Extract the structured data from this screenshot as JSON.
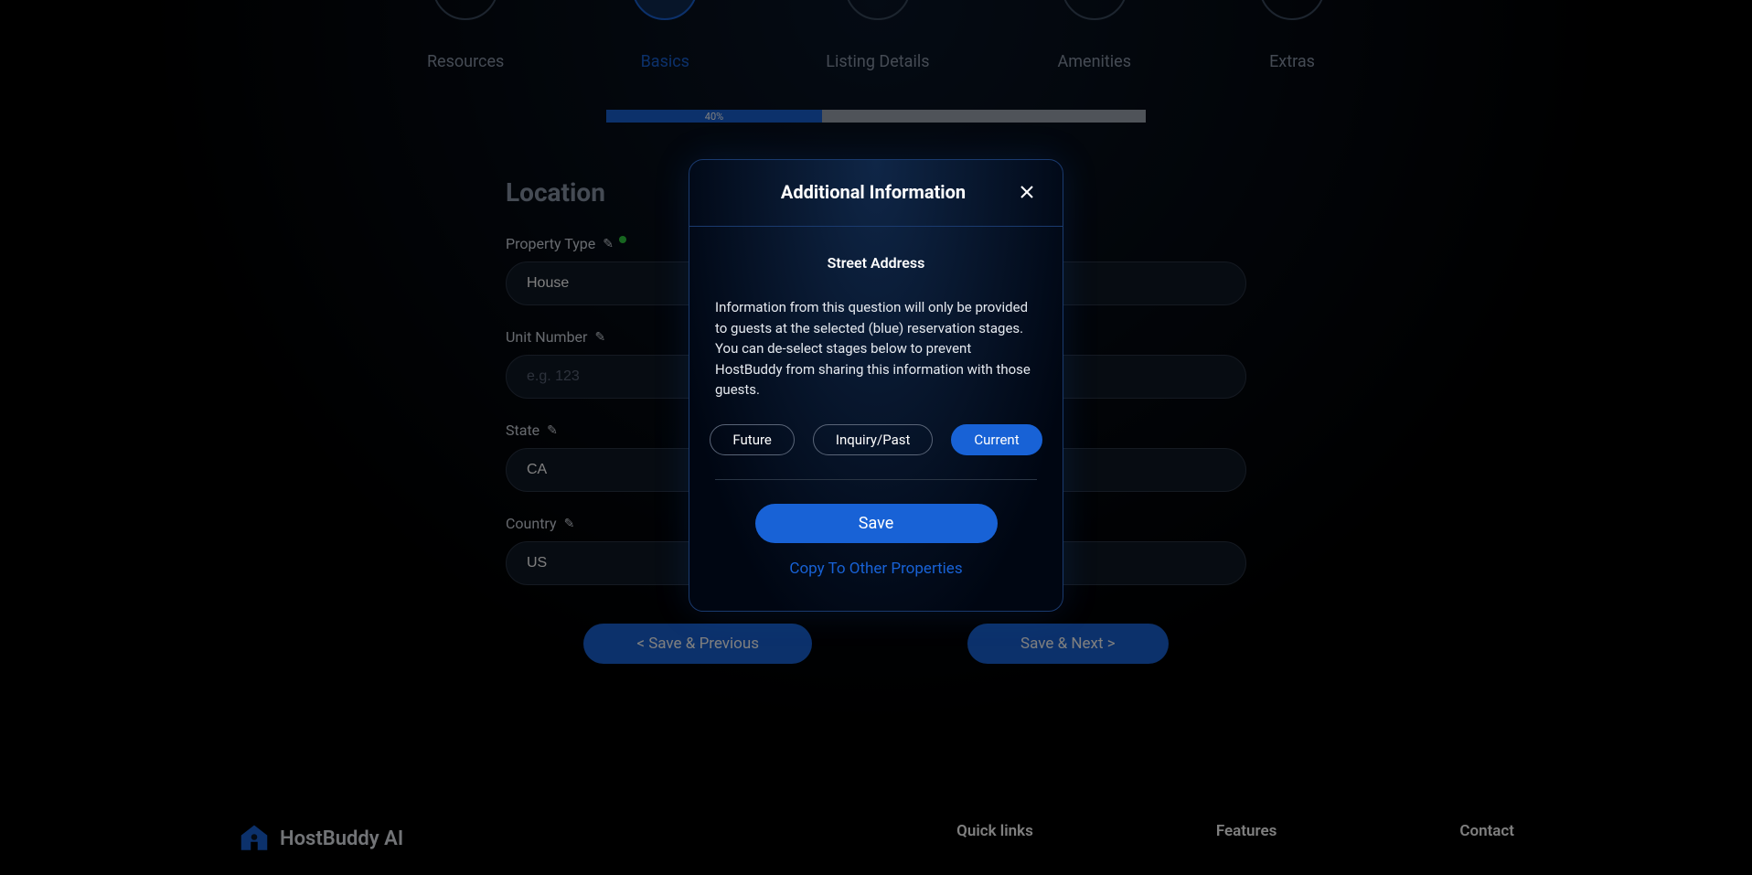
{
  "stepper": {
    "steps": [
      {
        "label": "Resources"
      },
      {
        "label": "Basics"
      },
      {
        "label": "Listing Details"
      },
      {
        "label": "Amenities"
      },
      {
        "label": "Extras"
      }
    ],
    "active_index": 1
  },
  "progress": {
    "percent_label": "40%"
  },
  "form": {
    "section_title": "Location",
    "fields": {
      "property_type": {
        "label": "Property Type",
        "value": "House"
      },
      "unit_number": {
        "label": "Unit Number",
        "placeholder": "e.g. 123",
        "value": ""
      },
      "state": {
        "label": "State",
        "value": "CA"
      },
      "country": {
        "label": "Country",
        "value": "US"
      }
    }
  },
  "nav": {
    "prev": "< Save & Previous",
    "next": "Save & Next >"
  },
  "modal": {
    "title": "Additional Information",
    "subtitle": "Street Address",
    "description": "Information from this question will only be provided to guests at the selected (blue) reservation stages. You can de-select stages below to prevent HostBuddy from sharing this information with those guests.",
    "stages": [
      {
        "label": "Future",
        "selected": false
      },
      {
        "label": "Inquiry/Past",
        "selected": false
      },
      {
        "label": "Current",
        "selected": true
      }
    ],
    "save": "Save",
    "copy_link": "Copy To Other Properties"
  },
  "footer": {
    "brand": "HostBuddy AI",
    "cols": [
      {
        "title": "Quick links"
      },
      {
        "title": "Features"
      },
      {
        "title": "Contact"
      }
    ]
  }
}
